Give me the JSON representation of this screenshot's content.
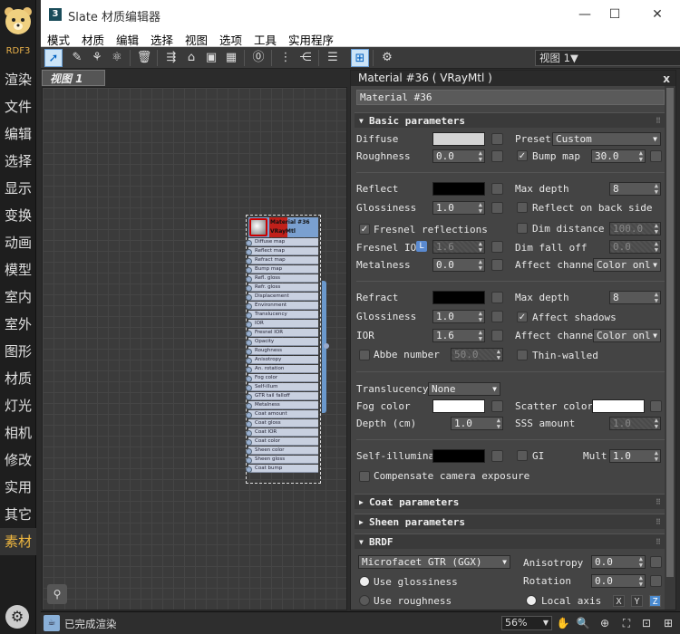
{
  "sidebar": {
    "logo_text": "RDF3",
    "items": [
      {
        "label": "渲染"
      },
      {
        "label": "文件"
      },
      {
        "label": "编辑"
      },
      {
        "label": "选择"
      },
      {
        "label": "显示"
      },
      {
        "label": "变换"
      },
      {
        "label": "动画"
      },
      {
        "label": "模型"
      },
      {
        "label": "室内"
      },
      {
        "label": "室外"
      },
      {
        "label": "图形"
      },
      {
        "label": "材质"
      },
      {
        "label": "灯光"
      },
      {
        "label": "相机"
      },
      {
        "label": "修改"
      },
      {
        "label": "实用"
      },
      {
        "label": "其它"
      },
      {
        "label": "素材"
      }
    ]
  },
  "window": {
    "app_icon": "3",
    "title": "Slate 材质编辑器",
    "minimize": "—",
    "maximize": "☐",
    "close": "✕"
  },
  "menu": [
    "模式",
    "材质",
    "编辑",
    "选择",
    "视图",
    "选项",
    "工具",
    "实用程序"
  ],
  "toolbar": {
    "view_select": "视图 1"
  },
  "view": {
    "tab_label": "视图 1",
    "node": {
      "title": "Material #36",
      "subtitle": "VRayMtl",
      "slots": [
        "Diffuse map",
        "Reflect map",
        "Refract map",
        "Bump map",
        "Refl. gloss",
        "Refr. gloss",
        "Displacement",
        "Environment",
        "Translucency",
        "IOR",
        "Fresnel IOR",
        "Opacity",
        "Roughness",
        "Anisotropy",
        "An. rotation",
        "Fog color",
        "Self-illum",
        "GTR tail falloff",
        "Metalness",
        "Coat amount",
        "Coat gloss",
        "Coat IOR",
        "Coat color",
        "Sheen color",
        "Sheen gloss",
        "Coat bump"
      ]
    }
  },
  "panel": {
    "title": "Material #36  ( VRayMtl )",
    "name": "Material #36",
    "sections": {
      "basic": "Basic parameters",
      "coat": "Coat parameters",
      "sheen": "Sheen parameters",
      "brdf": "BRDF"
    },
    "basic": {
      "diffuse": "Diffuse",
      "preset": "Preset",
      "preset_value": "Custom",
      "roughness": "Roughness",
      "roughness_value": "0.0",
      "bump_map": "Bump map",
      "bump_map_value": "30.0",
      "reflect": "Reflect",
      "max_depth": "Max depth",
      "refl_max_depth_value": "8",
      "glossiness": "Glossiness",
      "refl_gloss_value": "1.0",
      "reflect_back": "Reflect on back side",
      "fresnel": "Fresnel reflections",
      "dim_distance": "Dim distance",
      "dim_distance_value": "100.0",
      "fresnel_ior": "Fresnel IOR",
      "fresnel_ior_lock": "L",
      "fresnel_ior_value": "1.6",
      "dim_falloff": "Dim fall off",
      "dim_falloff_value": "0.0",
      "metalness": "Metalness",
      "metalness_value": "0.0",
      "affect_channel": "Affect channel",
      "affect_channel_value": "Color onl",
      "refract": "Refract",
      "refr_max_depth_value": "8",
      "refr_gloss_value": "1.0",
      "affect_shadows": "Affect shadows",
      "ior": "IOR",
      "ior_value": "1.6",
      "refr_affect_channel_value": "Color onl",
      "abbe": "Abbe number",
      "abbe_value": "50.0",
      "thin_walled": "Thin-walled",
      "translucency": "Translucency",
      "translucency_value": "None",
      "fog_color": "Fog color",
      "scatter_color": "Scatter color",
      "depth": "Depth (cm)",
      "depth_value": "1.0",
      "sss_amount": "SSS amount",
      "sss_amount_value": "1.0",
      "self_illum": "Self-illuminat",
      "gi": "GI",
      "mult": "Mult",
      "mult_value": "1.0",
      "compensate": "Compensate camera exposure"
    },
    "brdf": {
      "type_value": "Microfacet GTR (GGX)",
      "anisotropy": "Anisotropy",
      "anisotropy_value": "0.0",
      "use_glossiness": "Use glossiness",
      "rotation": "Rotation",
      "rotation_value": "0.0",
      "use_roughness": "Use roughness",
      "local_axis": "Local axis",
      "x": "X",
      "y": "Y",
      "z": "Z"
    },
    "colors": {
      "diffuse": "#d4d4d4",
      "reflect": "#000000",
      "refract": "#000000",
      "fog": "#ffffff",
      "scatter": "#ffffff",
      "self_illum": "#000000"
    }
  },
  "status": {
    "text": "已完成渲染",
    "zoom": "56%"
  }
}
